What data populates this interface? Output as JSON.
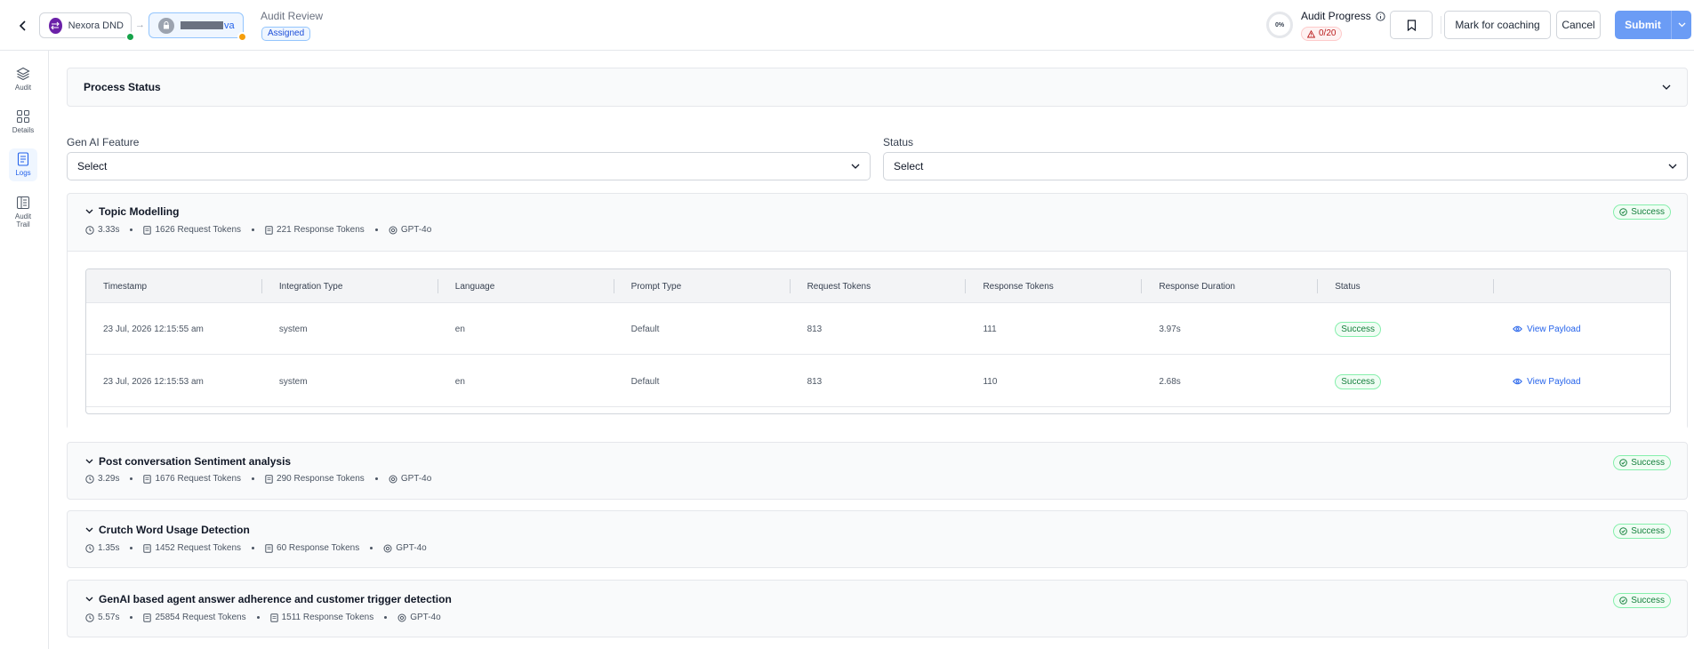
{
  "header": {
    "org_name": "Nexora DND",
    "agent_name_tail": "va",
    "review_title": "Audit Review",
    "review_status": "Assigned",
    "progress_percent": "0%",
    "progress_title": "Audit Progress",
    "progress_count": "0/20",
    "mark_coaching_label": "Mark for coaching",
    "cancel_label": "Cancel",
    "submit_label": "Submit"
  },
  "sidebar": {
    "items": [
      {
        "label": "Audit",
        "icon": "layers-icon"
      },
      {
        "label": "Details",
        "icon": "grid-icon"
      },
      {
        "label": "Logs",
        "icon": "document-icon",
        "active": true
      },
      {
        "label": "Audit Trail",
        "icon": "book-icon"
      }
    ]
  },
  "process_status": {
    "title": "Process Status"
  },
  "filters": {
    "gen_ai_label": "Gen AI Feature",
    "gen_ai_value": "Select",
    "status_label": "Status",
    "status_value": "Select"
  },
  "table": {
    "headers": [
      "Timestamp",
      "Integration Type",
      "Language",
      "Prompt Type",
      "Request Tokens",
      "Response Tokens",
      "Response Duration",
      "Status",
      ""
    ],
    "view_payload_label": "View Payload"
  },
  "features": [
    {
      "title": "Topic Modelling",
      "duration": "3.33s",
      "request_tokens": "1626 Request Tokens",
      "response_tokens": "221 Response Tokens",
      "model": "GPT-4o",
      "status": "Success",
      "expanded": true,
      "rows": [
        {
          "timestamp": "23 Jul, 2026 12:15:55 am",
          "integration": "system",
          "language": "en",
          "prompt": "Default",
          "req": "813",
          "resp": "111",
          "duration": "3.97s",
          "status": "Success"
        },
        {
          "timestamp": "23 Jul, 2026 12:15:53 am",
          "integration": "system",
          "language": "en",
          "prompt": "Default",
          "req": "813",
          "resp": "110",
          "duration": "2.68s",
          "status": "Success"
        }
      ]
    },
    {
      "title": "Post conversation Sentiment analysis",
      "duration": "3.29s",
      "request_tokens": "1676 Request Tokens",
      "response_tokens": "290 Response Tokens",
      "model": "GPT-4o",
      "status": "Success"
    },
    {
      "title": "Crutch Word Usage Detection",
      "duration": "1.35s",
      "request_tokens": "1452 Request Tokens",
      "response_tokens": "60 Response Tokens",
      "model": "GPT-4o",
      "status": "Success"
    },
    {
      "title": "GenAI based agent answer adherence and customer trigger detection",
      "duration": "5.57s",
      "request_tokens": "25854 Request Tokens",
      "response_tokens": "1511 Response Tokens",
      "model": "GPT-4o",
      "status": "Success"
    }
  ]
}
